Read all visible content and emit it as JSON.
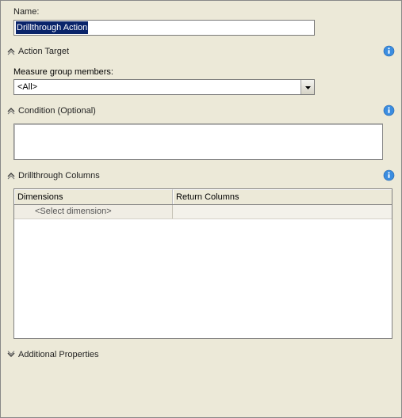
{
  "name": {
    "label": "Name:",
    "value": "Drillthrough Action"
  },
  "actionTarget": {
    "title": "Action Target",
    "measureGroupLabel": "Measure group members:",
    "measureGroupValue": "<All>"
  },
  "condition": {
    "title": "Condition (Optional)",
    "value": ""
  },
  "drillthrough": {
    "title": "Drillthrough Columns",
    "col1": "Dimensions",
    "col2": "Return Columns",
    "placeholderRow": "<Select dimension>"
  },
  "additional": {
    "title": "Additional Properties"
  }
}
